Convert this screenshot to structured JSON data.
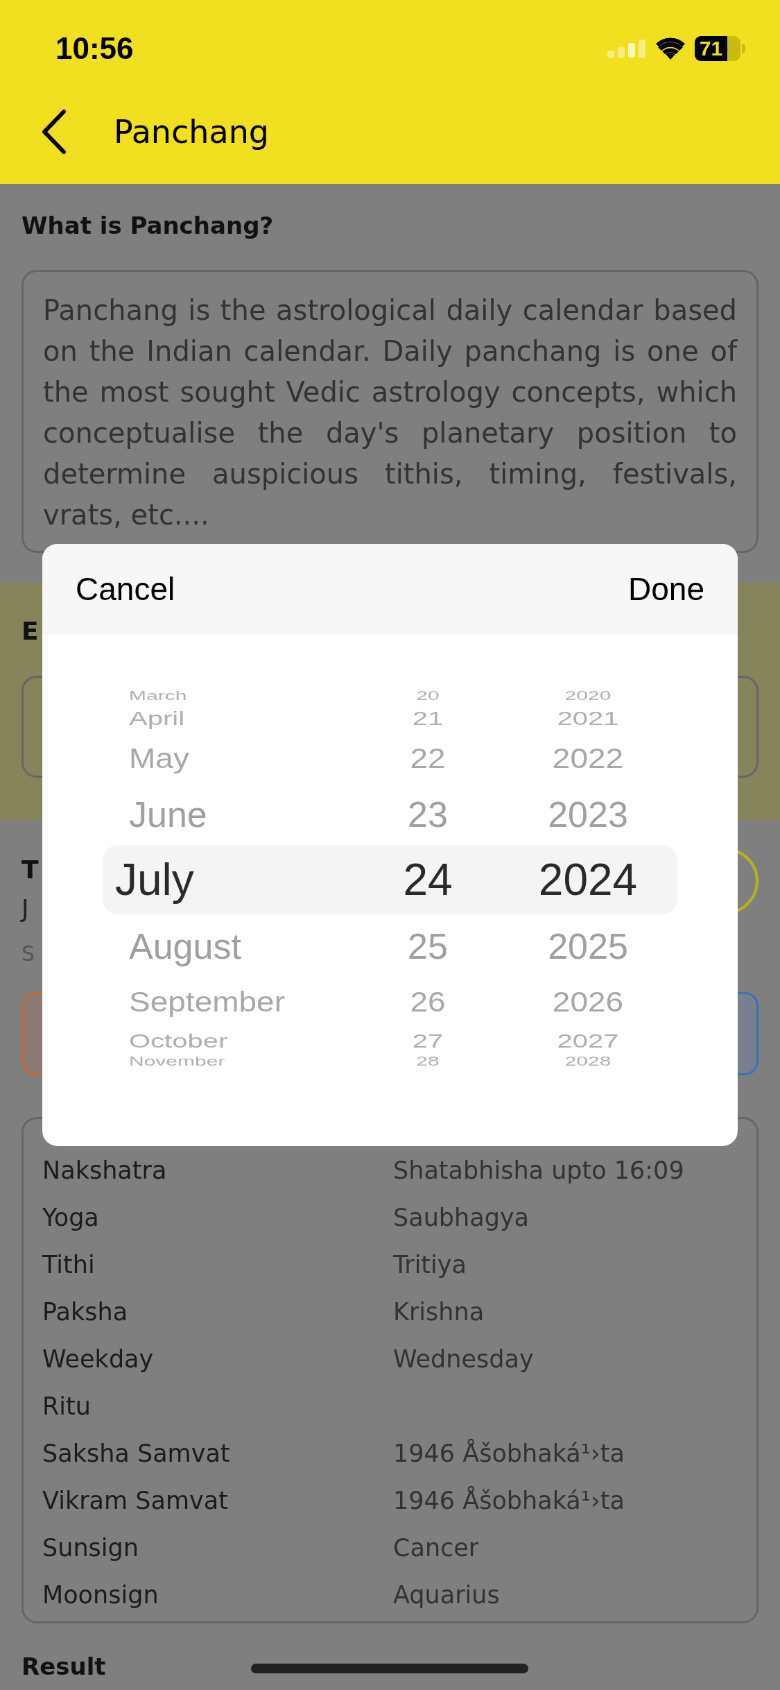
{
  "status_bar": {
    "time": "10:56",
    "battery": "71"
  },
  "header": {
    "title": "Panchang"
  },
  "intro": {
    "heading": "What is Panchang?",
    "text": "Panchang is the astrological daily calendar based on the Indian calendar. Daily panchang is one of the most sought Vedic astrology concepts, which conceptualise the day's planetary position to determine auspicious tithis, timing, festivals, vrats, etc...."
  },
  "background_fragments": [
    {
      "kind": "heading",
      "text": "E"
    },
    {
      "kind": "heading",
      "text": "T"
    },
    {
      "kind": "body",
      "text": "J"
    },
    {
      "kind": "caption",
      "text": "S"
    }
  ],
  "date_picker": {
    "cancel": "Cancel",
    "done": "Done",
    "columns": [
      {
        "kind": "month",
        "items": [
          {
            "label": "March",
            "selected": false
          },
          {
            "label": "April",
            "selected": false
          },
          {
            "label": "May",
            "selected": false
          },
          {
            "label": "June",
            "selected": false
          },
          {
            "label": "July",
            "selected": true
          },
          {
            "label": "August",
            "selected": false
          },
          {
            "label": "September",
            "selected": false
          },
          {
            "label": "October",
            "selected": false
          },
          {
            "label": "November",
            "selected": false
          }
        ]
      },
      {
        "kind": "day",
        "items": [
          {
            "label": "20",
            "selected": false
          },
          {
            "label": "21",
            "selected": false
          },
          {
            "label": "22",
            "selected": false
          },
          {
            "label": "23",
            "selected": false
          },
          {
            "label": "24",
            "selected": true
          },
          {
            "label": "25",
            "selected": false
          },
          {
            "label": "26",
            "selected": false
          },
          {
            "label": "27",
            "selected": false
          },
          {
            "label": "28",
            "selected": false
          }
        ]
      },
      {
        "kind": "year",
        "items": [
          {
            "label": "2020",
            "selected": false
          },
          {
            "label": "2021",
            "selected": false
          },
          {
            "label": "2022",
            "selected": false
          },
          {
            "label": "2023",
            "selected": false
          },
          {
            "label": "2024",
            "selected": true
          },
          {
            "label": "2025",
            "selected": false
          },
          {
            "label": "2026",
            "selected": false
          },
          {
            "label": "2027",
            "selected": false
          },
          {
            "label": "2028",
            "selected": false
          }
        ]
      }
    ]
  },
  "details": [
    {
      "label": "Nakshatra",
      "value": "Shatabhisha upto 16:09"
    },
    {
      "label": "Yoga",
      "value": "Saubhagya"
    },
    {
      "label": "Tithi",
      "value": "Tritiya"
    },
    {
      "label": "Paksha",
      "value": "Krishna"
    },
    {
      "label": "Weekday",
      "value": "Wednesday"
    },
    {
      "label": "Ritu"
    },
    {
      "label": "Saksha Samvat",
      "value": "1946 Åšobhaká¹›ta"
    },
    {
      "label": "Vikram Samvat",
      "value": "1946 Åšobhaká¹›ta"
    },
    {
      "label": "Sunsign",
      "value": "Cancer"
    },
    {
      "label": "Moonsign",
      "value": "Aquarius"
    }
  ],
  "result_heading": "Result"
}
